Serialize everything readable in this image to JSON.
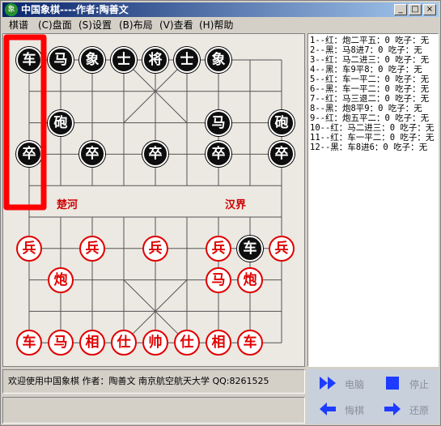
{
  "window": {
    "title": "中国象棋----作者:陶善文",
    "icon_glyph": "象",
    "minimize_glyph": "_",
    "maximize_glyph": "□",
    "close_glyph": "×"
  },
  "menu": [
    {
      "label": "棋谱"
    },
    {
      "label": "(C)盘面"
    },
    {
      "label": "(S)设置"
    },
    {
      "label": "(B)布局"
    },
    {
      "label": "(V)查看"
    },
    {
      "label": "(H)帮助"
    }
  ],
  "board": {
    "river_left": "楚河",
    "river_right": "汉界",
    "pieces": [
      {
        "label": "车",
        "side": "black",
        "col": 0,
        "row": 0
      },
      {
        "label": "马",
        "side": "black",
        "col": 1,
        "row": 0
      },
      {
        "label": "象",
        "side": "black",
        "col": 2,
        "row": 0
      },
      {
        "label": "士",
        "side": "black",
        "col": 3,
        "row": 0
      },
      {
        "label": "将",
        "side": "black",
        "col": 4,
        "row": 0
      },
      {
        "label": "士",
        "side": "black",
        "col": 5,
        "row": 0
      },
      {
        "label": "象",
        "side": "black",
        "col": 6,
        "row": 0
      },
      {
        "label": "砲",
        "side": "black",
        "col": 1,
        "row": 2
      },
      {
        "label": "马",
        "side": "black",
        "col": 6,
        "row": 2
      },
      {
        "label": "砲",
        "side": "black",
        "col": 8,
        "row": 2
      },
      {
        "label": "卒",
        "side": "black",
        "col": 0,
        "row": 3
      },
      {
        "label": "卒",
        "side": "black",
        "col": 2,
        "row": 3
      },
      {
        "label": "卒",
        "side": "black",
        "col": 4,
        "row": 3
      },
      {
        "label": "卒",
        "side": "black",
        "col": 6,
        "row": 3
      },
      {
        "label": "卒",
        "side": "black",
        "col": 8,
        "row": 3
      },
      {
        "label": "车",
        "side": "black",
        "col": 7,
        "row": 6
      },
      {
        "label": "兵",
        "side": "red",
        "col": 0,
        "row": 6
      },
      {
        "label": "兵",
        "side": "red",
        "col": 2,
        "row": 6
      },
      {
        "label": "兵",
        "side": "red",
        "col": 4,
        "row": 6
      },
      {
        "label": "兵",
        "side": "red",
        "col": 6,
        "row": 6
      },
      {
        "label": "兵",
        "side": "red",
        "col": 8,
        "row": 6
      },
      {
        "label": "炮",
        "side": "red",
        "col": 1,
        "row": 7
      },
      {
        "label": "马",
        "side": "red",
        "col": 6,
        "row": 7
      },
      {
        "label": "炮",
        "side": "red",
        "col": 7,
        "row": 7
      },
      {
        "label": "车",
        "side": "red",
        "col": 0,
        "row": 9
      },
      {
        "label": "马",
        "side": "red",
        "col": 1,
        "row": 9
      },
      {
        "label": "相",
        "side": "red",
        "col": 2,
        "row": 9
      },
      {
        "label": "仕",
        "side": "red",
        "col": 3,
        "row": 9
      },
      {
        "label": "帅",
        "side": "red",
        "col": 4,
        "row": 9
      },
      {
        "label": "仕",
        "side": "red",
        "col": 5,
        "row": 9
      },
      {
        "label": "相",
        "side": "red",
        "col": 6,
        "row": 9
      },
      {
        "label": "车",
        "side": "red",
        "col": 7,
        "row": 9
      }
    ]
  },
  "history": [
    "1--红：炮二平五：0 吃子：无",
    "2--黑：马8进7：0 吃子：无",
    "3--红：马二进三：0 吃子：无",
    "4--黑：车9平8：0 吃子：无",
    "5--红：车一平二：0 吃子：无",
    "6--黑：车一平二：0 吃子：无",
    "7--红：马三退二：0 吃子：无",
    "8--黑：炮8平9：0 吃子：无",
    "9--红：炮五平二：0 吃子：无",
    "10--红：马二进三：0 吃子：无",
    "11--红：车一平二：0 吃子：无",
    "12--黑：车8进6：0 吃子：无"
  ],
  "status": {
    "line1": "欢迎使用中国象棋  作者：陶善文  南京航空航天大学    QQ:8261525",
    "line2": ""
  },
  "controls": [
    {
      "label": "电脑",
      "icon": "double-play-icon"
    },
    {
      "label": "停止",
      "icon": "stop-icon"
    },
    {
      "label": "悔棋",
      "icon": "undo-arrow-icon"
    },
    {
      "label": "还原",
      "icon": "redo-arrow-icon"
    }
  ],
  "colors": {
    "title_gradient_start": "#0a246a",
    "red_piece": "#e00000",
    "black_piece": "#0e0e0e",
    "highlight": "#ff0000",
    "control_blue": "#1e3cff"
  }
}
